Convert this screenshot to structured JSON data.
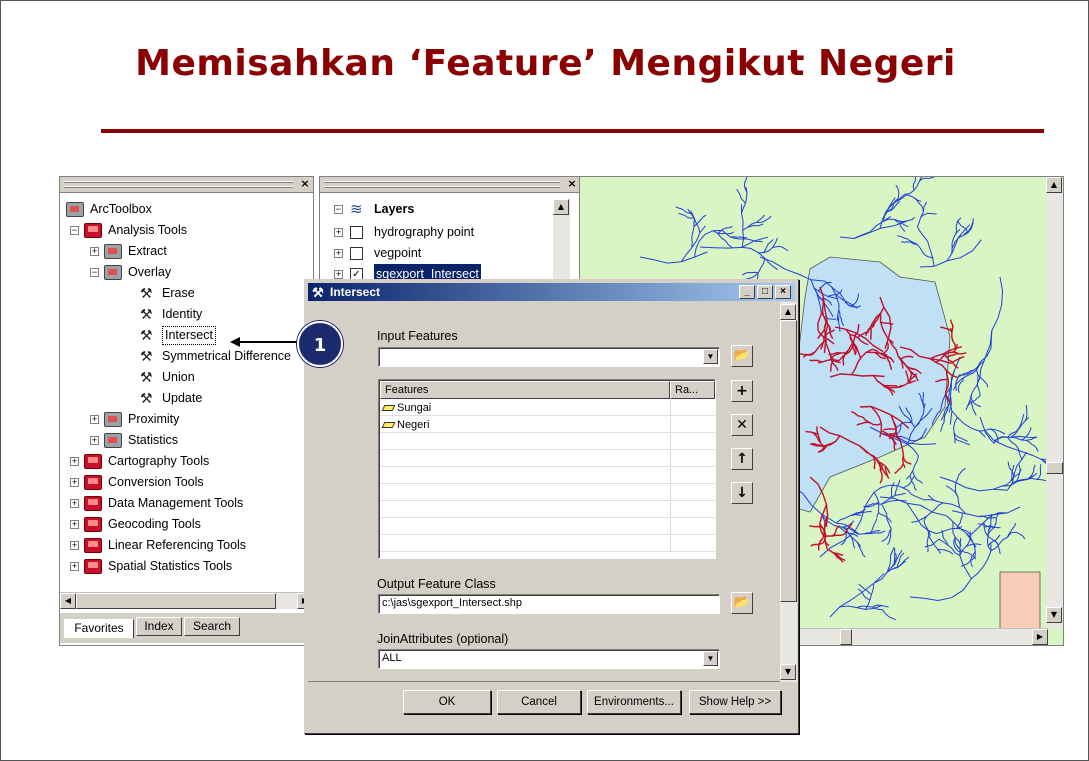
{
  "slide": {
    "title": "Memisahkan ‘Feature’ Mengikut Negeri",
    "accent": "#8b0000"
  },
  "toolbox": {
    "root": "ArcToolbox",
    "items": [
      {
        "label": "Analysis Tools"
      },
      {
        "label": "Extract"
      },
      {
        "label": "Overlay"
      },
      {
        "label": "Erase"
      },
      {
        "label": "Identity"
      },
      {
        "label": "Intersect"
      },
      {
        "label": "Symmetrical Difference"
      },
      {
        "label": "Union"
      },
      {
        "label": "Update"
      },
      {
        "label": "Proximity"
      },
      {
        "label": "Statistics"
      },
      {
        "label": "Cartography Tools"
      },
      {
        "label": "Conversion Tools"
      },
      {
        "label": "Data Management Tools"
      },
      {
        "label": "Geocoding Tools"
      },
      {
        "label": "Linear Referencing Tools"
      },
      {
        "label": "Spatial Statistics Tools"
      }
    ],
    "tabs": [
      "Favorites",
      "Index",
      "Search"
    ]
  },
  "toc": {
    "root": "Layers",
    "layers": [
      {
        "label": "hydrography point"
      },
      {
        "label": "vegpoint"
      },
      {
        "label": "sgexport_Intersect"
      }
    ]
  },
  "callout": {
    "number": "1",
    "color": "#1a2b6e"
  },
  "dialog": {
    "title": "Intersect",
    "input_label": "Input Features",
    "input_value": "",
    "table": {
      "headers": [
        "Features",
        "Ra..."
      ],
      "rows": [
        "Sungai",
        "Negeri"
      ]
    },
    "output_label": "Output Feature Class",
    "output_value": "c:\\jas\\sgexport_Intersect.shp",
    "join_label": "JoinAttributes (optional)",
    "join_value": "ALL",
    "buttons": {
      "ok": "OK",
      "cancel": "Cancel",
      "env": "Environments...",
      "help": "Show Help >>"
    }
  },
  "map": {
    "land_color": "#d9f5c3",
    "state_color": "#bfe0f5",
    "river_color": "#1e3fd6",
    "selected_color": "#c0102c"
  }
}
